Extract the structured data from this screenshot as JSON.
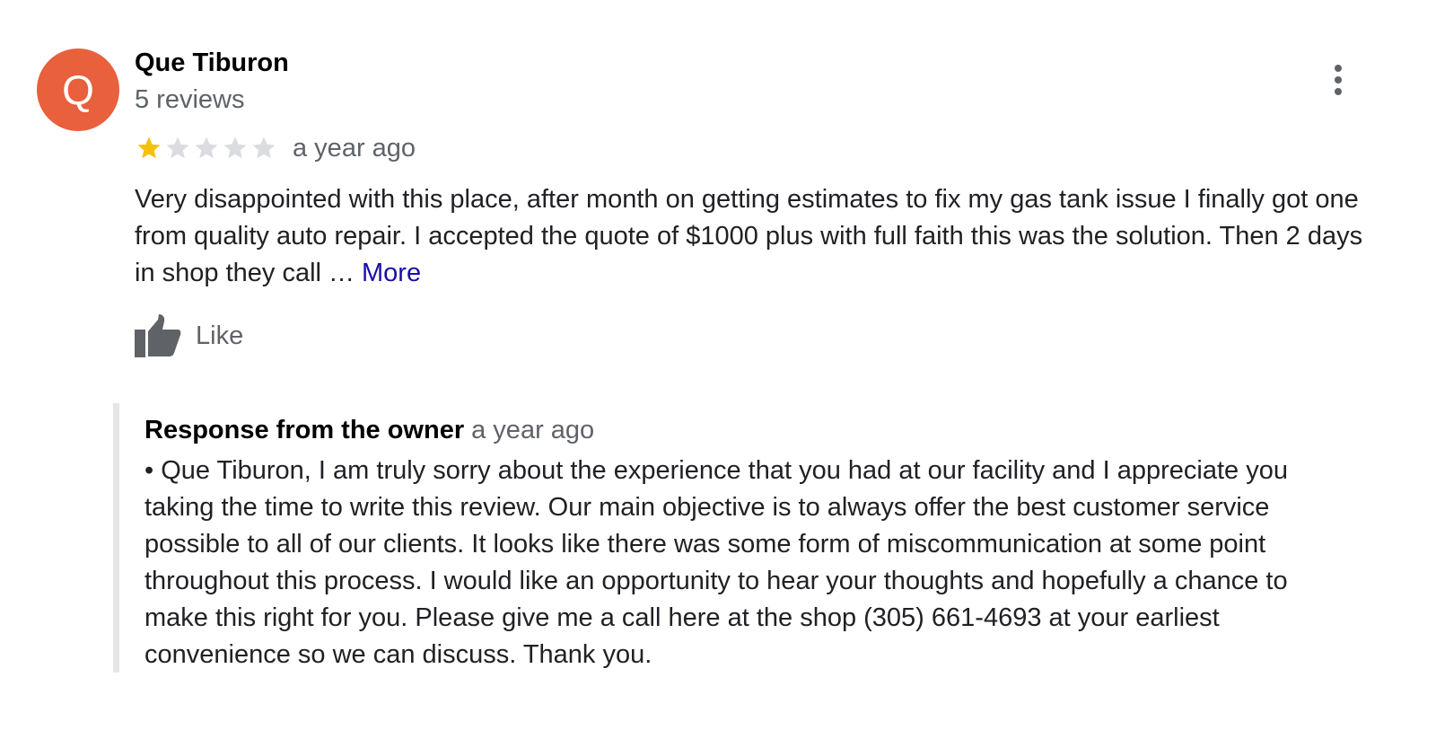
{
  "reviewer": {
    "initial": "Q",
    "name": "Que Tiburon",
    "review_count": "5 reviews",
    "avatar_color": "#e8603c"
  },
  "rating": {
    "stars": 1,
    "max_stars": 5,
    "filled_color": "#f4c20d",
    "empty_color": "#dadce0"
  },
  "review": {
    "date": "a year ago",
    "text": "Very disappointed with this place, after month on getting estimates to fix my gas tank issue I finally got one from quality auto repair. I accepted the quote of $1000 plus with full faith this was the solution. Then 2 days in shop they call …",
    "more_label": "More"
  },
  "actions": {
    "like_label": "Like",
    "more_icon": "more-vertical-icon",
    "like_icon": "thumbs-up-icon"
  },
  "owner_response": {
    "title": "Response from the owner",
    "date": "a year ago",
    "text": "• Que Tiburon, I am truly sorry about the experience that you had at our facility and I appreciate you taking the time to write this review. Our main objective is to always offer the best customer service possible to all of our clients. It looks like there was some form of miscommunication at some point throughout this process. I would like an opportunity to hear your thoughts and hopefully a chance to make this right for you. Please give me a call here at the shop (305) 661-4693 at your earliest convenience so we can discuss. Thank you."
  }
}
